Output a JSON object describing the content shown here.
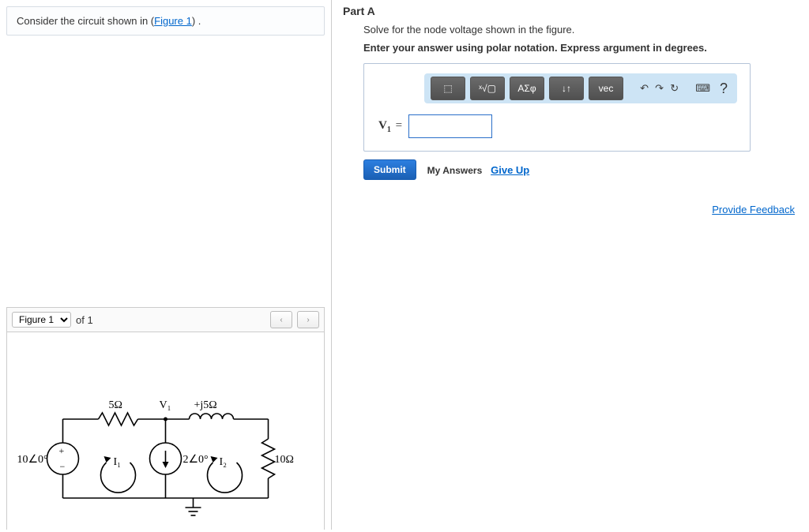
{
  "prompt": {
    "pre": "Consider the circuit shown in (",
    "link": "Figure 1",
    "post": ") ."
  },
  "figure": {
    "select_value": "Figure 1",
    "of_text": "of 1",
    "prev": "‹",
    "next": "›"
  },
  "circuit": {
    "source_label": "10∠0°",
    "r1_label": "5Ω",
    "v1_label": "V₁",
    "l_label": "+j5Ω",
    "i1_label": "I₁",
    "cs_label": "2∠0°",
    "i2_label": "I₂",
    "r2_label": "10Ω"
  },
  "part": {
    "title": "Part A",
    "instruction": "Solve for the node voltage shown in the figure.",
    "instruction_strong": "Enter your answer using polar notation. Express argument in degrees."
  },
  "toolbar": {
    "template": "⬚",
    "sqrt": "ˣ√▢",
    "greek": "ΑΣφ",
    "script": "↓↑",
    "vec": "vec",
    "undo": "↶",
    "redo": "↷",
    "reset": "↻",
    "keyboard": "⌨",
    "help": "?"
  },
  "answer": {
    "label_html": "V",
    "label_sub": "1",
    "equals": "=",
    "value": ""
  },
  "actions": {
    "submit": "Submit",
    "my_answers": "My Answers",
    "give_up": "Give Up"
  },
  "feedback_link": "Provide Feedback"
}
